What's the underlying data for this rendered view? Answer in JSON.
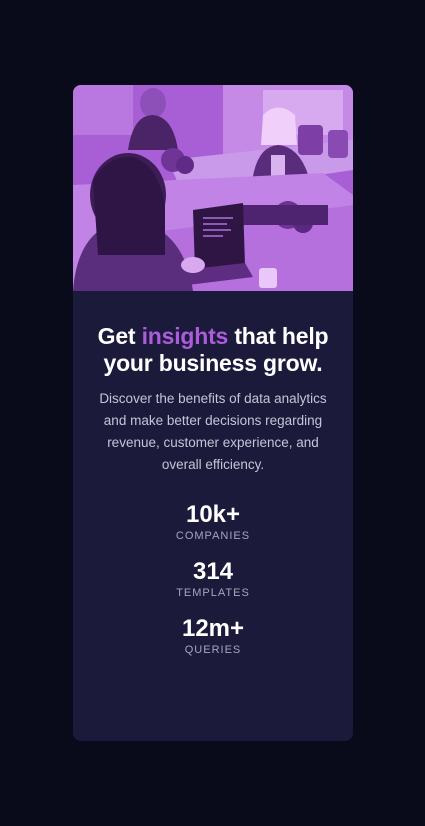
{
  "card": {
    "headline": {
      "before": "Get ",
      "accent": "insights",
      "after": " that help your business grow."
    },
    "description": "Discover the benefits of data analytics and make better decisions regarding revenue, customer experience, and overall efficiency.",
    "stats": [
      {
        "value": "10k+",
        "label": "COMPANIES"
      },
      {
        "value": "314",
        "label": "TEMPLATES"
      },
      {
        "value": "12m+",
        "label": "QUERIES"
      }
    ]
  },
  "colors": {
    "page_background": "#090b1a",
    "card_background": "#1c1a3b",
    "accent": "#aa5cdb",
    "headline": "#ffffff",
    "body_text": "#c6c4d6",
    "stat_label": "#a7a5be"
  }
}
